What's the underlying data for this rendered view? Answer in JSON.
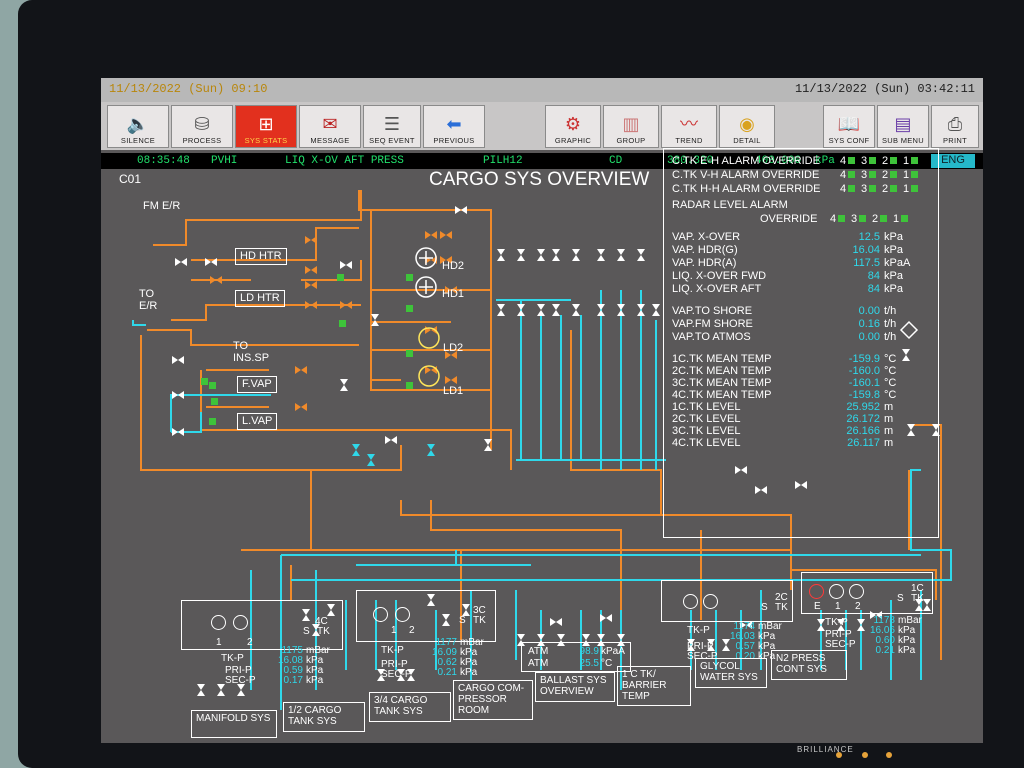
{
  "header": {
    "left_datetime": "11/13/2022 (Sun) 09:10",
    "right_datetime": "11/13/2022 (Sun) 03:42:11"
  },
  "toolbar": {
    "buttons": [
      {
        "label": "SILENCE",
        "icon": "speaker-icon"
      },
      {
        "label": "PROCESS",
        "icon": "process-icon"
      },
      {
        "label": "SYS STATS",
        "icon": "network-icon"
      },
      {
        "label": "MESSAGE",
        "icon": "envelope-icon"
      },
      {
        "label": "SEQ EVENT",
        "icon": "list-icon"
      },
      {
        "label": "PREVIOUS",
        "icon": "arrow-left-icon"
      },
      {
        "label": "GRAPHIC",
        "icon": "graphic-icon"
      },
      {
        "label": "GROUP",
        "icon": "bars-icon"
      },
      {
        "label": "TREND",
        "icon": "trend-icon"
      },
      {
        "label": "DETAIL",
        "icon": "detail-icon"
      },
      {
        "label": "SYS CONF",
        "icon": "book-icon"
      },
      {
        "label": "SUB MENU",
        "icon": "submenu-icon"
      },
      {
        "label": "PRINT",
        "icon": "printer-icon"
      }
    ],
    "active_color": "#e2301e"
  },
  "status": {
    "time": "08:35:48",
    "code": "PVHI",
    "message": "LIQ X-OV AFT PRESS",
    "tag": "PILH12",
    "flag": "CD",
    "value": "380.320",
    "limit": "400.000",
    "unit": "kPa",
    "lang": "ENG"
  },
  "diagram": {
    "page_id": "C01",
    "title": "CARGO SYS OVERVIEW",
    "labels": {
      "fm_er": "FM E/R",
      "to_er_1": "TO",
      "to_er_2": "E/R",
      "hd_htr": "HD HTR",
      "ld_htr": "LD HTR",
      "to_ins_1": "TO",
      "to_ins_2": "INS.SP",
      "fvap": "F.VAP",
      "lvap": "L.VAP",
      "hd2": "HD2",
      "hd1": "HD1",
      "ld2": "LD2",
      "ld1": "LD1"
    },
    "colors": {
      "orange_pipe": "#f08a2a",
      "cyan_pipe": "#2fd8ea",
      "valve": "#ffffff",
      "ok_square": "#3ec33a"
    }
  },
  "panel": {
    "overrides": [
      {
        "label": "C.TK E-H ALARM OVERRIDE",
        "nums": [
          "4",
          "3",
          "2",
          "1"
        ]
      },
      {
        "label": "C.TK V-H ALARM OVERRIDE",
        "nums": [
          "4",
          "3",
          "2",
          "1"
        ]
      },
      {
        "label": "C.TK H-H ALARM OVERRIDE",
        "nums": [
          "4",
          "3",
          "2",
          "1"
        ]
      }
    ],
    "radar_label": "RADAR LEVEL ALARM",
    "radar_override": {
      "label": "OVERRIDE",
      "nums": [
        "4",
        "3",
        "2",
        "1"
      ]
    },
    "vapor": [
      {
        "label": "VAP. X-OVER",
        "value": "12.5",
        "unit": "kPa"
      },
      {
        "label": "VAP. HDR(G)",
        "value": "16.04",
        "unit": "kPa"
      },
      {
        "label": "VAP. HDR(A)",
        "value": "117.5",
        "unit": "kPaA"
      },
      {
        "label": "LIQ. X-OVER FWD",
        "value": "84",
        "unit": "kPa"
      },
      {
        "label": "LIQ. X-OVER AFT",
        "value": "84",
        "unit": "kPa"
      }
    ],
    "shore": [
      {
        "label": "VAP.TO SHORE",
        "value": "0.00",
        "unit": "t/h"
      },
      {
        "label": "VAP.FM SHORE",
        "value": "0.16",
        "unit": "t/h"
      },
      {
        "label": "VAP.TO ATMOS",
        "value": "0.00",
        "unit": "t/h"
      }
    ],
    "tanks": [
      {
        "label": "1C.TK MEAN TEMP",
        "value": "-159.9",
        "unit": "°C"
      },
      {
        "label": "2C.TK MEAN TEMP",
        "value": "-160.0",
        "unit": "°C"
      },
      {
        "label": "3C.TK MEAN TEMP",
        "value": "-160.1",
        "unit": "°C"
      },
      {
        "label": "4C.TK MEAN TEMP",
        "value": "-159.8",
        "unit": "°C"
      },
      {
        "label": "1C.TK LEVEL",
        "value": "25.952",
        "unit": "m"
      },
      {
        "label": "2C.TK LEVEL",
        "value": "26.172",
        "unit": "m"
      },
      {
        "label": "3C.TK LEVEL",
        "value": "26.166",
        "unit": "m"
      },
      {
        "label": "4C.TK LEVEL",
        "value": "26.117",
        "unit": "m"
      }
    ]
  },
  "tanks_bottom": {
    "t4": {
      "name": "4C",
      "s": "S",
      "tk": "TK",
      "g1": "1",
      "g2": "2",
      "tkp": "TK-P",
      "pri": "PRI-P",
      "sec": "SEC-P",
      "v1": "1175",
      "u1": "mBar",
      "v2": "16.08",
      "u2": "kPa",
      "v3": "0.59",
      "u3": "kPa",
      "v4": "0.17",
      "u4": "kPa"
    },
    "t3": {
      "name": "3C",
      "s": "S",
      "tk": "TK",
      "g1": "1",
      "g2": "2",
      "tkp": "TK-P",
      "pri": "PRI-P",
      "sec": "SEC-P",
      "v1": "1177",
      "u1": "mBar",
      "v2": "16.09",
      "u2": "kPa",
      "v3": "0.62",
      "u3": "kPa",
      "v4": "0.21",
      "u4": "kPa"
    },
    "t2": {
      "name": "2C",
      "s": "S",
      "tk": "TK",
      "g1": "1",
      "g2": "2",
      "tkp": "TK-P",
      "pri": "PRI-P",
      "sec": "SEC-P",
      "v1": "1174",
      "u1": "mBar",
      "v2": "16.03",
      "u2": "kPa",
      "v3": "0.57",
      "u3": "kPa",
      "v4": "0.20",
      "u4": "kPa"
    },
    "t1": {
      "name": "1C",
      "s": "S",
      "tk": "TK",
      "e": "E",
      "g1": "1",
      "g2": "2",
      "tkp": "TK-P",
      "pri": "PRI-P",
      "sec": "SEC-P",
      "v1": "1178",
      "u1": "mBar",
      "v2": "16.06",
      "u2": "kPa",
      "v3": "0.60",
      "u3": "kPa",
      "v4": "0.21",
      "u4": "kPa"
    },
    "atm": {
      "label1": "ATM",
      "val1": "98.9",
      "unit1": "kPaA",
      "label2": "ATM",
      "val2": "25.5",
      "unit2": "°C"
    }
  },
  "nav": [
    {
      "text": "MANIFOLD SYS"
    },
    {
      "text": "1/2 CARGO TANK SYS"
    },
    {
      "text": "3/4 CARGO TANK SYS"
    },
    {
      "text": "CARGO COM-PRESSOR ROOM"
    },
    {
      "text": "BALLAST SYS OVERVIEW"
    },
    {
      "text": "1 C TK/ BARRIER TEMP"
    },
    {
      "text": "GLYCOL WATER SYS"
    },
    {
      "text": "N2 PRESS CONT SYS"
    }
  ],
  "bezel": {
    "brand": "BRILLIANCE"
  }
}
